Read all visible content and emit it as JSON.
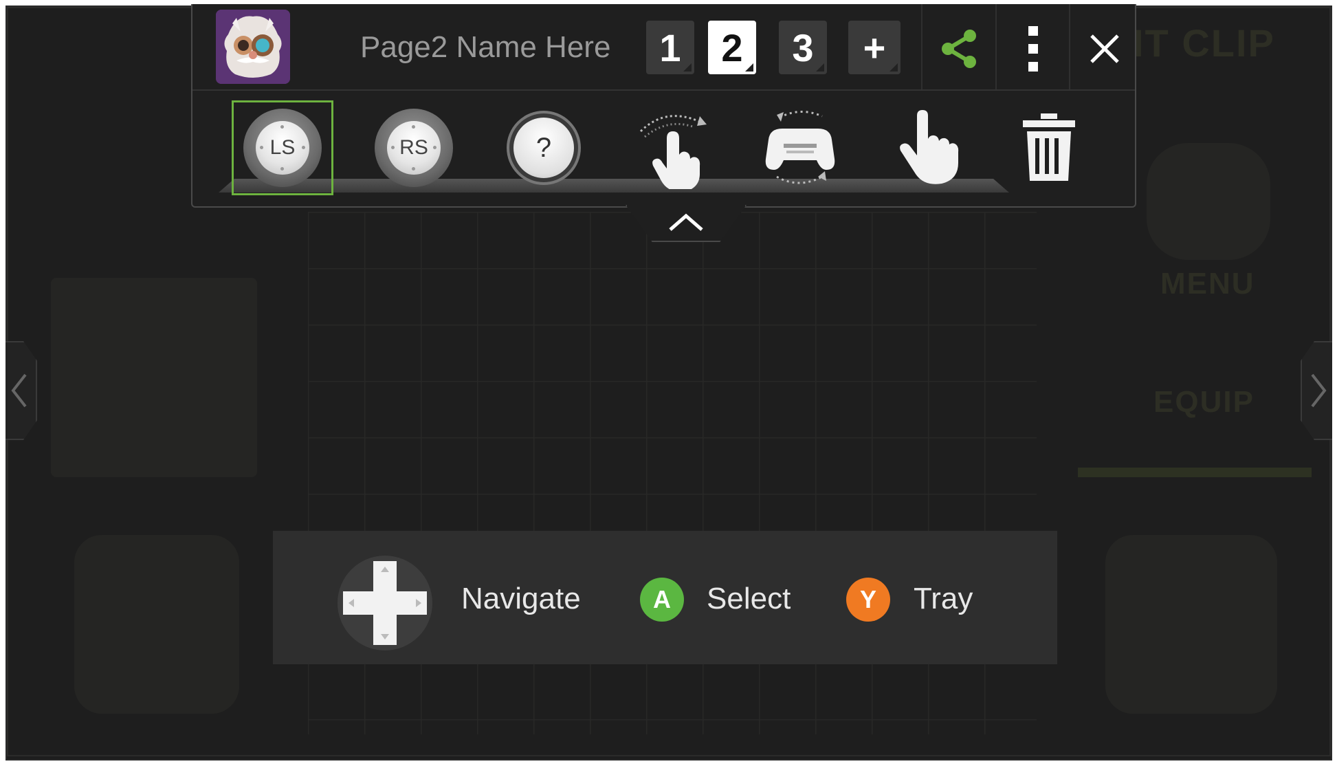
{
  "toolbar": {
    "page_name": "Page2 Name Here",
    "pages": [
      {
        "label": "1",
        "active": false
      },
      {
        "label": "2",
        "active": true
      },
      {
        "label": "3",
        "active": false
      }
    ],
    "add_page_label": "+",
    "share_icon": "share-icon",
    "more_icon": "more-vertical-icon",
    "close_icon": "close-icon"
  },
  "tools": {
    "left_stick": "LS",
    "right_stick": "RS",
    "unknown": "?",
    "swipe_icon": "swipe-gesture-icon",
    "tilt_icon": "controller-tilt-icon",
    "tap_icon": "tap-hand-icon",
    "delete_icon": "trash-icon",
    "selected": "left_stick"
  },
  "hints": {
    "navigate": "Navigate",
    "select_button": "A",
    "select": "Select",
    "tray_button": "Y",
    "tray": "Tray"
  },
  "background": {
    "text_top_right": "IT CLIP",
    "text_menu": "MENU",
    "text_equip": "EQUIP"
  },
  "colors": {
    "accent_green": "#6db33f",
    "a_button": "#5bb741",
    "y_button": "#f07a22"
  }
}
